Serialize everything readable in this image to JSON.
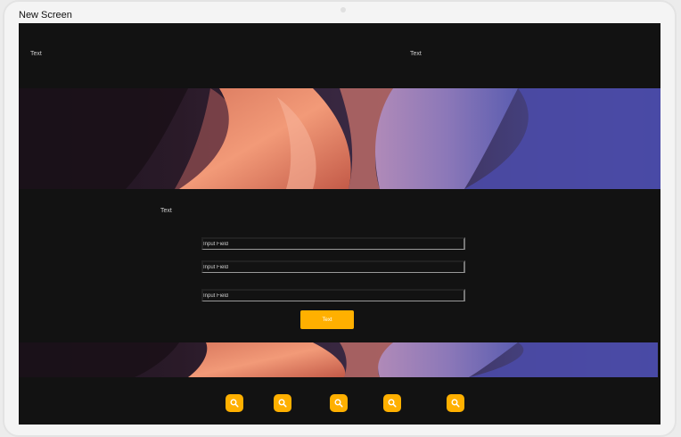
{
  "screen": {
    "title": "New Screen"
  },
  "header": {
    "left_text": "Text",
    "right_text": "Text"
  },
  "section": {
    "text": "Text"
  },
  "form": {
    "fields": [
      {
        "placeholder": "Input Field"
      },
      {
        "placeholder": "Input Field"
      },
      {
        "placeholder": "Input Field"
      }
    ],
    "submit_label": "Text"
  },
  "footer": {
    "icons": [
      "search-icon",
      "search-icon",
      "search-icon",
      "search-icon",
      "search-icon"
    ]
  },
  "colors": {
    "background": "#121212",
    "accent": "#ffb000",
    "frame": "#f4f4f4"
  }
}
